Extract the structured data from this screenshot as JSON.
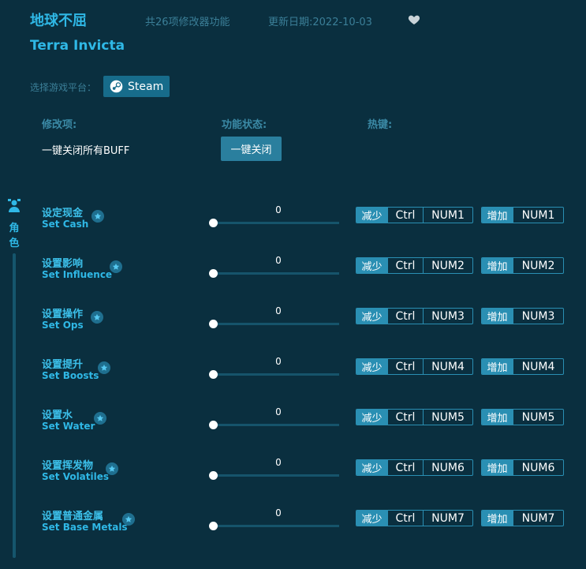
{
  "header": {
    "title": "地球不屈",
    "count_text": "共26项修改器功能",
    "date_text": "更新日期:2022-10-03",
    "subtitle": "Terra Invicta"
  },
  "platform": {
    "label": "选择游戏平台：",
    "steam_label": "Steam"
  },
  "columns": {
    "mod": "修改项:",
    "status": "功能状态:",
    "hotkey": "热键:"
  },
  "all_buff": {
    "label": "一键关闭所有BUFF",
    "button": "一键关闭"
  },
  "side": {
    "label": "角色"
  },
  "key_tags": {
    "decrease": "减少",
    "increase": "增加",
    "modifier": "Ctrl"
  },
  "rows": [
    {
      "cn": "设定现金",
      "en": "Set Cash",
      "value": "0",
      "key": "NUM1"
    },
    {
      "cn": "设置影响",
      "en": "Set Influence",
      "value": "0",
      "key": "NUM2"
    },
    {
      "cn": "设置操作",
      "en": "Set Ops",
      "value": "0",
      "key": "NUM3"
    },
    {
      "cn": "设置提升",
      "en": "Set Boosts",
      "value": "0",
      "key": "NUM4"
    },
    {
      "cn": "设置水",
      "en": "Set Water",
      "value": "0",
      "key": "NUM5"
    },
    {
      "cn": "设置挥发物",
      "en": "Set Volatiles",
      "value": "0",
      "key": "NUM6"
    },
    {
      "cn": "设置普通金属",
      "en": "Set Base Metals",
      "value": "0",
      "key": "NUM7"
    }
  ],
  "colors": {
    "background": "#0a2f3f",
    "accent": "#2fb8e6",
    "button": "#2a8fb3"
  }
}
